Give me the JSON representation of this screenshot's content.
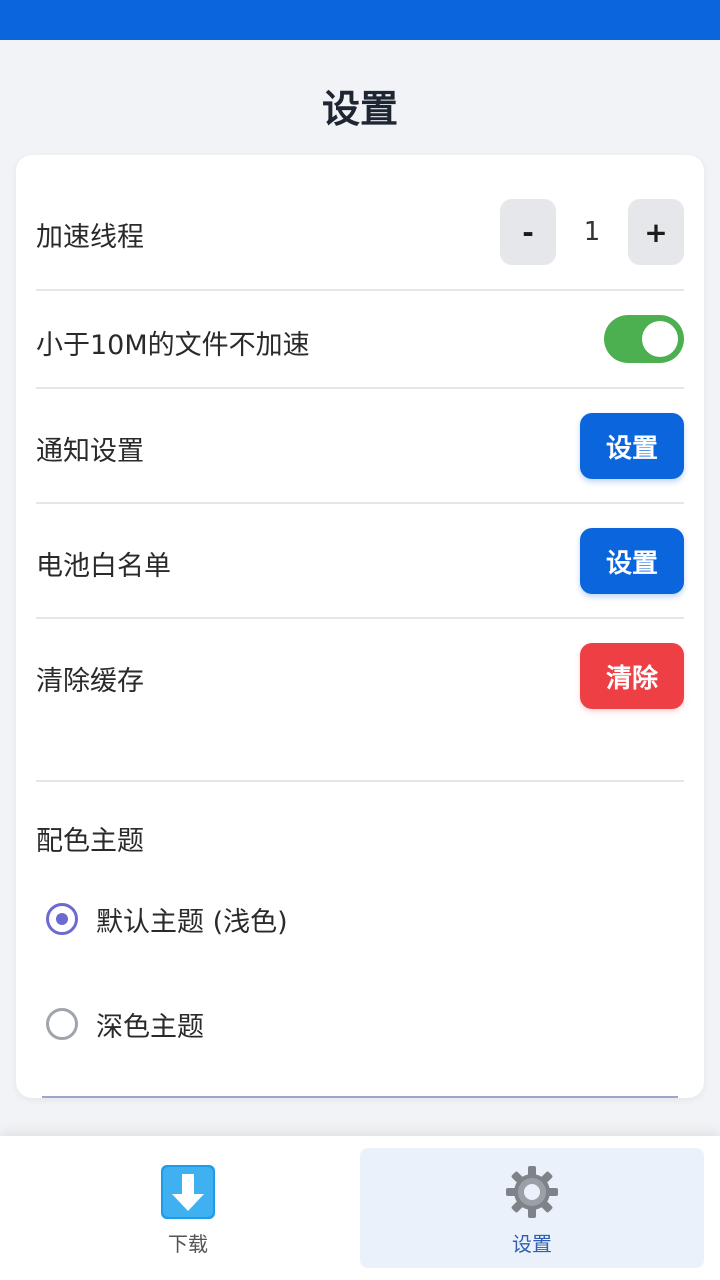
{
  "page": {
    "title": "设置"
  },
  "settings": {
    "threads": {
      "label": "加速线程",
      "decrement": "-",
      "value": "1",
      "increment": "+"
    },
    "small_file": {
      "label": "小于10M的文件不加速",
      "enabled": true
    },
    "notification": {
      "label": "通知设置",
      "button": "设置"
    },
    "battery": {
      "label": "电池白名单",
      "button": "设置"
    },
    "cache": {
      "label": "清除缓存",
      "button": "清除"
    }
  },
  "theme": {
    "title": "配色主题",
    "options": [
      {
        "label": "默认主题 (浅色)",
        "selected": true
      },
      {
        "label": "深色主题",
        "selected": false
      }
    ]
  },
  "nav": {
    "items": [
      {
        "label": "下载",
        "icon": "download-arrow-icon",
        "active": false
      },
      {
        "label": "设置",
        "icon": "gear-icon",
        "active": true
      }
    ]
  },
  "colors": {
    "accent": "#0b65dc",
    "danger": "#ee3f44",
    "toggle_on": "#4caf50",
    "radio": "#6a6ad2"
  }
}
